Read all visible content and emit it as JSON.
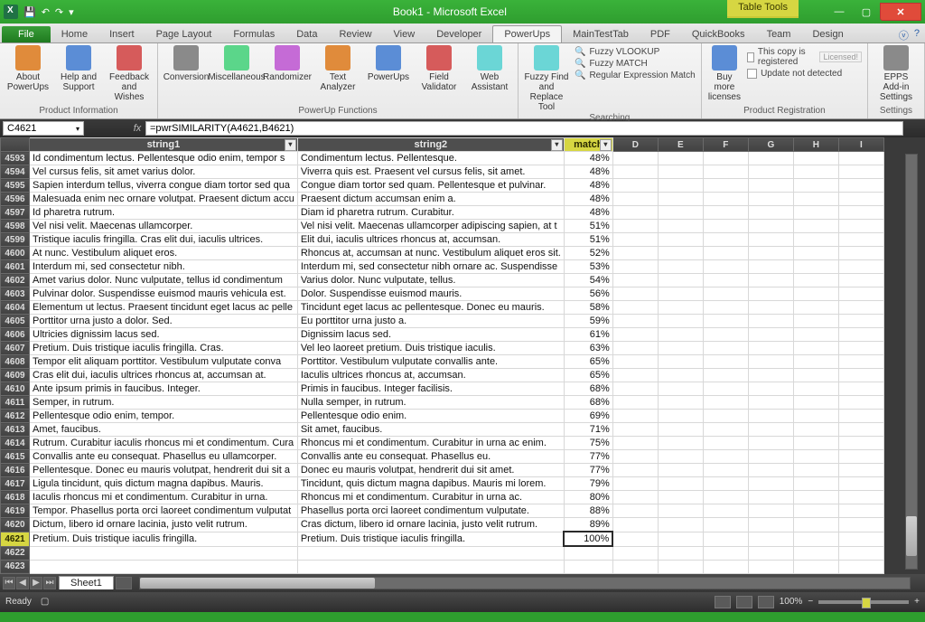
{
  "window": {
    "title": "Book1 - Microsoft Excel",
    "context_tab": "Table Tools"
  },
  "tabs": {
    "file": "File",
    "items": [
      "Home",
      "Insert",
      "Page Layout",
      "Formulas",
      "Data",
      "Review",
      "View",
      "Developer",
      "PowerUps",
      "MainTestTab",
      "PDF",
      "QuickBooks",
      "Team",
      "Design"
    ],
    "active": "PowerUps"
  },
  "ribbon": {
    "groups": {
      "product_info": {
        "label": "Product Information",
        "buttons": [
          "About PowerUps",
          "Help and Support",
          "Feedback and Wishes"
        ]
      },
      "pu_functions": {
        "label": "PowerUp Functions",
        "buttons": [
          "Conversion",
          "Miscellaneous",
          "Randomizer",
          "Text Analyzer",
          "PowerUps",
          "Field Validator",
          "Web Assistant"
        ]
      },
      "searching": {
        "label": "Searching",
        "big": "Fuzzy Find and Replace Tool",
        "items": [
          "Fuzzy VLOOKUP",
          "Fuzzy MATCH",
          "Regular Expression Match"
        ]
      },
      "registration": {
        "label": "Product Registration",
        "big": "Buy more licenses",
        "items": [
          "This copy is registered",
          "Update not detected"
        ],
        "badge": "Licensed!"
      },
      "settings": {
        "label": "Settings",
        "buttons": [
          "EPPS Add-in Settings"
        ]
      }
    }
  },
  "namebox": "C4621",
  "formula": "=pwrSIMILARITY(A4621,B4621)",
  "columns": {
    "string1": "string1",
    "string2": "string2",
    "match": "match",
    "extra": [
      "D",
      "E",
      "F",
      "G",
      "H",
      "I"
    ]
  },
  "rows": [
    {
      "n": 4593,
      "a": "Id condimentum lectus. Pellentesque odio enim, tempor s",
      "b": "Condimentum lectus. Pellentesque.",
      "m": "48%"
    },
    {
      "n": 4594,
      "a": "Vel cursus felis, sit amet varius dolor.",
      "b": "Viverra quis est. Praesent vel cursus felis, sit amet.",
      "m": "48%"
    },
    {
      "n": 4595,
      "a": "Sapien interdum tellus, viverra congue diam tortor sed qua",
      "b": "Congue diam tortor sed quam. Pellentesque et pulvinar.",
      "m": "48%"
    },
    {
      "n": 4596,
      "a": "Malesuada enim nec ornare volutpat. Praesent dictum accu",
      "b": "Praesent dictum accumsan enim a.",
      "m": "48%"
    },
    {
      "n": 4597,
      "a": "Id pharetra rutrum.",
      "b": "Diam id pharetra rutrum. Curabitur.",
      "m": "48%"
    },
    {
      "n": 4598,
      "a": "Vel nisi velit. Maecenas ullamcorper.",
      "b": "Vel nisi velit. Maecenas ullamcorper adipiscing sapien, at t",
      "m": "51%"
    },
    {
      "n": 4599,
      "a": "Tristique iaculis fringilla. Cras elit dui, iaculis ultrices.",
      "b": "Elit dui, iaculis ultrices rhoncus at, accumsan.",
      "m": "51%"
    },
    {
      "n": 4600,
      "a": "At nunc. Vestibulum aliquet eros.",
      "b": "Rhoncus at, accumsan at nunc. Vestibulum aliquet eros sit.",
      "m": "52%"
    },
    {
      "n": 4601,
      "a": "Interdum mi, sed consectetur nibh.",
      "b": "Interdum mi, sed consectetur nibh ornare ac. Suspendisse",
      "m": "53%"
    },
    {
      "n": 4602,
      "a": "Amet varius dolor. Nunc vulputate, tellus id condimentum",
      "b": "Varius dolor. Nunc vulputate, tellus.",
      "m": "54%"
    },
    {
      "n": 4603,
      "a": "Pulvinar dolor. Suspendisse euismod mauris vehicula est.",
      "b": "Dolor. Suspendisse euismod mauris.",
      "m": "56%"
    },
    {
      "n": 4604,
      "a": "Elementum ut lectus. Praesent tincidunt eget lacus ac pelle",
      "b": "Tincidunt eget lacus ac pellentesque. Donec eu mauris.",
      "m": "58%"
    },
    {
      "n": 4605,
      "a": "Porttitor urna justo a dolor. Sed.",
      "b": "Eu porttitor urna justo a.",
      "m": "59%"
    },
    {
      "n": 4606,
      "a": "Ultricies dignissim lacus sed.",
      "b": "Dignissim lacus sed.",
      "m": "61%"
    },
    {
      "n": 4607,
      "a": "Pretium. Duis tristique iaculis fringilla. Cras.",
      "b": "Vel leo laoreet pretium. Duis tristique iaculis.",
      "m": "63%"
    },
    {
      "n": 4608,
      "a": "Tempor elit aliquam porttitor. Vestibulum vulputate conva",
      "b": "Porttitor. Vestibulum vulputate convallis ante.",
      "m": "65%"
    },
    {
      "n": 4609,
      "a": "Cras elit dui, iaculis ultrices rhoncus at, accumsan at.",
      "b": "Iaculis ultrices rhoncus at, accumsan.",
      "m": "65%"
    },
    {
      "n": 4610,
      "a": "Ante ipsum primis in faucibus. Integer.",
      "b": "Primis in faucibus. Integer facilisis.",
      "m": "68%"
    },
    {
      "n": 4611,
      "a": "Semper, in rutrum.",
      "b": "Nulla semper, in rutrum.",
      "m": "68%"
    },
    {
      "n": 4612,
      "a": "Pellentesque odio enim, tempor.",
      "b": "Pellentesque odio enim.",
      "m": "69%"
    },
    {
      "n": 4613,
      "a": "Amet, faucibus.",
      "b": "Sit amet, faucibus.",
      "m": "71%"
    },
    {
      "n": 4614,
      "a": "Rutrum. Curabitur iaculis rhoncus mi et condimentum. Cura",
      "b": "Rhoncus mi et condimentum. Curabitur in urna ac enim.",
      "m": "75%"
    },
    {
      "n": 4615,
      "a": "Convallis ante eu consequat. Phasellus eu ullamcorper.",
      "b": "Convallis ante eu consequat. Phasellus eu.",
      "m": "77%"
    },
    {
      "n": 4616,
      "a": "Pellentesque. Donec eu mauris volutpat, hendrerit dui sit a",
      "b": "Donec eu mauris volutpat, hendrerit dui sit amet.",
      "m": "77%"
    },
    {
      "n": 4617,
      "a": "Ligula tincidunt, quis dictum magna dapibus. Mauris.",
      "b": "Tincidunt, quis dictum magna dapibus. Mauris mi lorem.",
      "m": "79%"
    },
    {
      "n": 4618,
      "a": "Iaculis rhoncus mi et condimentum. Curabitur in urna.",
      "b": "Rhoncus mi et condimentum. Curabitur in urna ac.",
      "m": "80%"
    },
    {
      "n": 4619,
      "a": "Tempor. Phasellus porta orci laoreet condimentum vulputat",
      "b": "Phasellus porta orci laoreet condimentum vulputate.",
      "m": "88%"
    },
    {
      "n": 4620,
      "a": "Dictum, libero id ornare lacinia, justo velit rutrum.",
      "b": "Cras dictum, libero id ornare lacinia, justo velit rutrum.",
      "m": "89%"
    },
    {
      "n": 4621,
      "a": "Pretium. Duis tristique iaculis fringilla.",
      "b": "Pretium. Duis tristique iaculis fringilla.",
      "m": "100%",
      "selected": true
    }
  ],
  "empty_rows": [
    4622,
    4623
  ],
  "sheet_tab": "Sheet1",
  "status": {
    "mode": "Ready",
    "zoom": "100%"
  }
}
